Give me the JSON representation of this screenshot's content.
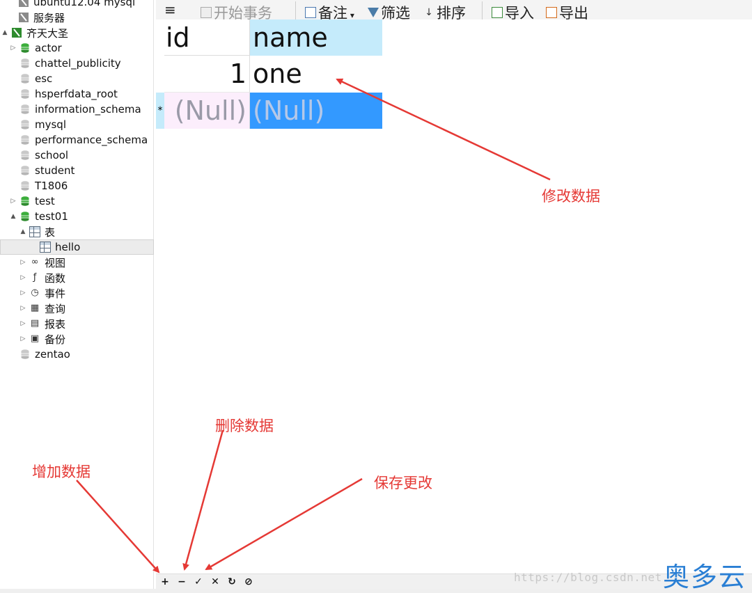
{
  "sidebar": {
    "items": [
      {
        "label": "ubuntu12.04 mysql",
        "icon": "server-icon",
        "arrow": ""
      },
      {
        "label": "服务器",
        "icon": "server-icon",
        "arrow": ""
      },
      {
        "label": "齐天大圣",
        "icon": "connection-icon",
        "arrow": "▲"
      },
      {
        "label": "actor",
        "icon": "database-open-icon",
        "arrow": "▷"
      },
      {
        "label": "chattel_publicity",
        "icon": "database-icon",
        "arrow": ""
      },
      {
        "label": "esc",
        "icon": "database-icon",
        "arrow": ""
      },
      {
        "label": "hsperfdata_root",
        "icon": "database-icon",
        "arrow": ""
      },
      {
        "label": "information_schema",
        "icon": "database-icon",
        "arrow": ""
      },
      {
        "label": "mysql",
        "icon": "database-icon",
        "arrow": ""
      },
      {
        "label": "performance_schema",
        "icon": "database-icon",
        "arrow": ""
      },
      {
        "label": "school",
        "icon": "database-icon",
        "arrow": ""
      },
      {
        "label": "student",
        "icon": "database-icon",
        "arrow": ""
      },
      {
        "label": "T1806",
        "icon": "database-icon",
        "arrow": ""
      },
      {
        "label": "test",
        "icon": "database-open-icon",
        "arrow": "▷"
      },
      {
        "label": "test01",
        "icon": "database-open-icon",
        "arrow": "▲"
      },
      {
        "label": "表",
        "icon": "table-icon",
        "arrow": "▲"
      },
      {
        "label": "hello",
        "icon": "table-icon",
        "arrow": ""
      },
      {
        "label": "视图",
        "icon": "view-icon",
        "arrow": "▷"
      },
      {
        "label": "函数",
        "icon": "function-icon",
        "arrow": "▷"
      },
      {
        "label": "事件",
        "icon": "event-icon",
        "arrow": "▷"
      },
      {
        "label": "查询",
        "icon": "query-icon",
        "arrow": "▷"
      },
      {
        "label": "报表",
        "icon": "report-icon",
        "arrow": "▷"
      },
      {
        "label": "备份",
        "icon": "backup-icon",
        "arrow": "▷"
      },
      {
        "label": "zentao",
        "icon": "database-icon",
        "arrow": ""
      }
    ]
  },
  "toolbar": {
    "menu_icon": "≡",
    "begin_transaction": "开始事务",
    "memo": "备注",
    "filter": "筛选",
    "sort": "排序",
    "import": "导入",
    "export": "导出"
  },
  "grid": {
    "columns": [
      "id",
      "name"
    ],
    "rows": [
      {
        "indicator": "",
        "id": "1",
        "name": "one"
      },
      {
        "indicator": "*",
        "id": "(Null)",
        "name": "(Null)"
      }
    ]
  },
  "bottom_bar": {
    "buttons": [
      {
        "glyph": "+",
        "icon": "add-icon"
      },
      {
        "glyph": "−",
        "icon": "minus-icon"
      },
      {
        "glyph": "✓",
        "icon": "check-icon"
      },
      {
        "glyph": "✕",
        "icon": "cancel-icon"
      },
      {
        "glyph": "↻",
        "icon": "refresh-icon"
      },
      {
        "glyph": "⊘",
        "icon": "stop-icon"
      }
    ]
  },
  "annotations": {
    "modify": "修改数据",
    "delete": "删除数据",
    "add": "增加数据",
    "save": "保存更改"
  },
  "watermark": {
    "url": "https://blog.csdn.net",
    "logo": "奥多云"
  },
  "colors": {
    "annotation": "#e53935",
    "header_name_bg": "#c5ebfb",
    "selected_cell_bg": "#3399ff",
    "new_row_bg": "#fceefc",
    "logo": "#2a7fd4"
  }
}
